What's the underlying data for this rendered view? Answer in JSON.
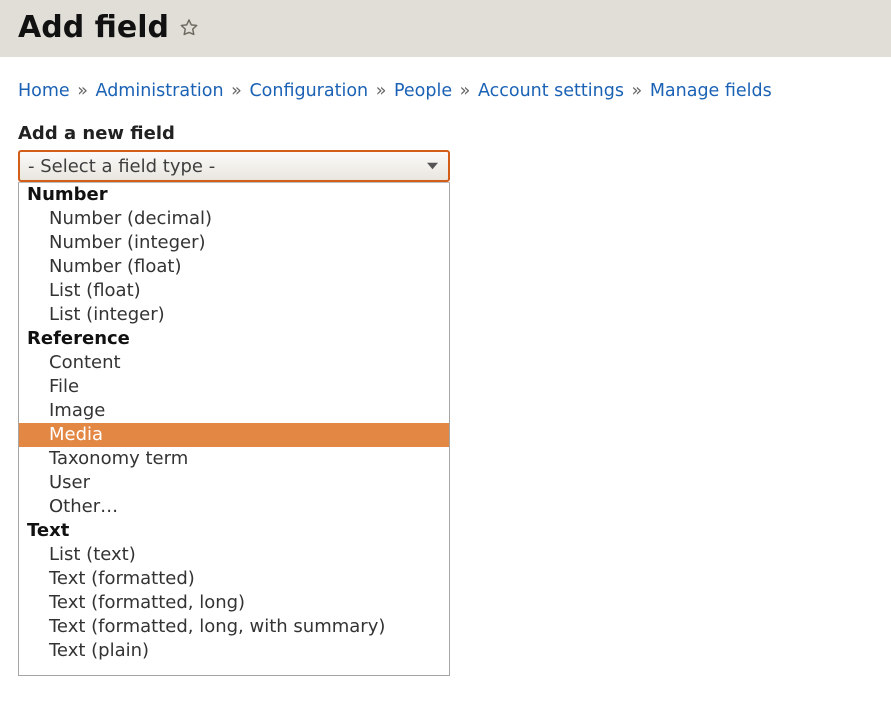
{
  "header": {
    "title": "Add field"
  },
  "breadcrumbs": {
    "items": [
      "Home",
      "Administration",
      "Configuration",
      "People",
      "Account settings",
      "Manage fields"
    ],
    "separator": "»"
  },
  "form": {
    "label": "Add a new field",
    "select_placeholder": "- Select a field type -",
    "selected_value": "Media",
    "groups": [
      {
        "label": "Number",
        "options": [
          "Number (decimal)",
          "Number (integer)",
          "Number (float)",
          "List (float)",
          "List (integer)"
        ]
      },
      {
        "label": "Reference",
        "options": [
          "Content",
          "File",
          "Image",
          "Media",
          "Taxonomy term",
          "User",
          "Other…"
        ]
      },
      {
        "label": "Text",
        "options": [
          "List (text)",
          "Text (formatted)",
          "Text (formatted, long)",
          "Text (formatted, long, with summary)",
          "Text (plain)"
        ]
      }
    ]
  }
}
